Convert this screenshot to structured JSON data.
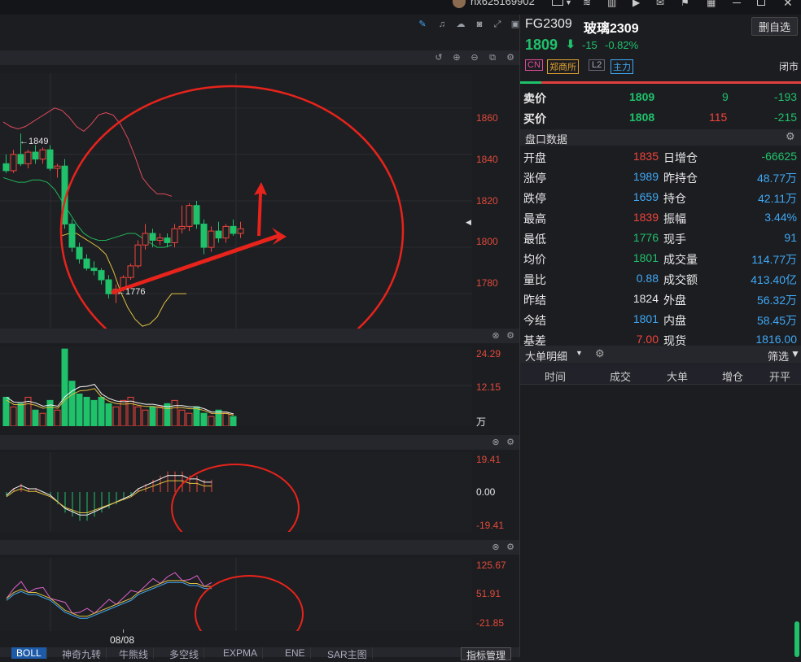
{
  "topbar": {
    "username": "hx625169902"
  },
  "pane_icons": {
    "toolbar_top": [
      "pen-icon",
      "bell-icon",
      "cloud-icon",
      "camera-icon",
      "fullscreen-icon",
      "layout-icon"
    ],
    "toolbar_chart": [
      "undo-icon",
      "zoom-in-icon",
      "zoom-out-icon",
      "crop-icon",
      "settings-icon"
    ]
  },
  "price_axis": [
    "1860",
    "1840",
    "1820",
    "1800",
    "1780"
  ],
  "volume_axis": [
    "24.29",
    "12.15",
    "万"
  ],
  "macd_axis": [
    "19.41",
    "0.00",
    "-19.41"
  ],
  "kdj_axis": [
    "125.67",
    "51.91",
    "-21.85"
  ],
  "annotations": {
    "high": "←1849",
    "low": "←1776"
  },
  "date_label": "08/08",
  "bottom_tabs": [
    "BOLL",
    "神奇九转",
    "牛熊线",
    "多空线",
    "EXPMA",
    "ENE",
    "SAR主图"
  ],
  "indicator_button": "指标管理",
  "quote": {
    "code": "FG2309",
    "name": "玻璃2309",
    "watch_button": "删自选",
    "price": "1809",
    "change": "-15",
    "change_pct": "-0.82%",
    "tags": [
      "CN",
      "郑商所",
      "L2",
      "主力"
    ],
    "status": "闭市"
  },
  "orderbook": [
    {
      "label": "卖价",
      "price": "1809",
      "vol": "9",
      "delta": "-193"
    },
    {
      "label": "买价",
      "price": "1808",
      "vol": "115",
      "delta": "-215"
    }
  ],
  "handicap_title": "盘口数据",
  "handicap": [
    {
      "l1": "开盘",
      "v1": "1835",
      "c1": "red",
      "l2": "日增仓",
      "v2": "-66625",
      "c2": "green"
    },
    {
      "l1": "涨停",
      "v1": "1989",
      "c1": "cyan",
      "l2": "昨持仓",
      "v2": "48.77万",
      "c2": "cyan"
    },
    {
      "l1": "跌停",
      "v1": "1659",
      "c1": "cyan",
      "l2": "持仓",
      "v2": "42.11万",
      "c2": "cyan"
    },
    {
      "l1": "最高",
      "v1": "1839",
      "c1": "red",
      "l2": "振幅",
      "v2": "3.44%",
      "c2": "cyan"
    },
    {
      "l1": "最低",
      "v1": "1776",
      "c1": "green",
      "l2": "现手",
      "v2": "91",
      "c2": "cyan"
    },
    {
      "l1": "均价",
      "v1": "1801",
      "c1": "green",
      "l2": "成交量",
      "v2": "114.77万",
      "c2": "cyan"
    },
    {
      "l1": "量比",
      "v1": "0.88",
      "c1": "cyan",
      "l2": "成交额",
      "v2": "413.40亿",
      "c2": "cyan"
    },
    {
      "l1": "昨结",
      "v1": "1824",
      "c1": "white",
      "l2": "外盘",
      "v2": "56.32万",
      "c2": "cyan"
    },
    {
      "l1": "今结",
      "v1": "1801",
      "c1": "cyan",
      "l2": "内盘",
      "v2": "58.45万",
      "c2": "cyan"
    },
    {
      "l1": "基差",
      "v1": "7.00",
      "c1": "red",
      "l2": "现货",
      "v2": "1816.00",
      "c2": "cyan"
    }
  ],
  "bigorder": {
    "title": "大单明细",
    "filter": "筛选",
    "columns": [
      "时间",
      "成交",
      "大单",
      "增仓",
      "开平"
    ]
  },
  "chart_data": {
    "type": "candlestick",
    "candles": [
      {
        "o": 1836,
        "h": 1840,
        "l": 1832,
        "c": 1833
      },
      {
        "o": 1833,
        "h": 1842,
        "l": 1832,
        "c": 1840
      },
      {
        "o": 1840,
        "h": 1849,
        "l": 1835,
        "c": 1836
      },
      {
        "o": 1836,
        "h": 1842,
        "l": 1834,
        "c": 1841
      },
      {
        "o": 1841,
        "h": 1844,
        "l": 1836,
        "c": 1838
      },
      {
        "o": 1838,
        "h": 1843,
        "l": 1836,
        "c": 1842
      },
      {
        "o": 1842,
        "h": 1844,
        "l": 1833,
        "c": 1834
      },
      {
        "o": 1834,
        "h": 1836,
        "l": 1830,
        "c": 1835
      },
      {
        "o": 1835,
        "h": 1838,
        "l": 1808,
        "c": 1810
      },
      {
        "o": 1810,
        "h": 1812,
        "l": 1798,
        "c": 1800
      },
      {
        "o": 1800,
        "h": 1802,
        "l": 1793,
        "c": 1795
      },
      {
        "o": 1795,
        "h": 1797,
        "l": 1790,
        "c": 1791
      },
      {
        "o": 1791,
        "h": 1794,
        "l": 1788,
        "c": 1790
      },
      {
        "o": 1790,
        "h": 1791,
        "l": 1784,
        "c": 1786
      },
      {
        "o": 1786,
        "h": 1788,
        "l": 1778,
        "c": 1780
      },
      {
        "o": 1780,
        "h": 1784,
        "l": 1776,
        "c": 1782
      },
      {
        "o": 1782,
        "h": 1788,
        "l": 1781,
        "c": 1787
      },
      {
        "o": 1787,
        "h": 1793,
        "l": 1786,
        "c": 1792
      },
      {
        "o": 1792,
        "h": 1803,
        "l": 1791,
        "c": 1801
      },
      {
        "o": 1801,
        "h": 1810,
        "l": 1799,
        "c": 1806
      },
      {
        "o": 1806,
        "h": 1808,
        "l": 1800,
        "c": 1803
      },
      {
        "o": 1803,
        "h": 1806,
        "l": 1801,
        "c": 1804
      },
      {
        "o": 1804,
        "h": 1806,
        "l": 1800,
        "c": 1802
      },
      {
        "o": 1802,
        "h": 1810,
        "l": 1800,
        "c": 1808
      },
      {
        "o": 1808,
        "h": 1818,
        "l": 1806,
        "c": 1809
      },
      {
        "o": 1809,
        "h": 1819,
        "l": 1807,
        "c": 1818
      },
      {
        "o": 1818,
        "h": 1820,
        "l": 1808,
        "c": 1810
      },
      {
        "o": 1810,
        "h": 1812,
        "l": 1797,
        "c": 1800
      },
      {
        "o": 1800,
        "h": 1809,
        "l": 1798,
        "c": 1807
      },
      {
        "o": 1807,
        "h": 1811,
        "l": 1802,
        "c": 1804
      },
      {
        "o": 1804,
        "h": 1810,
        "l": 1802,
        "c": 1809
      },
      {
        "o": 1809,
        "h": 1812,
        "l": 1805,
        "c": 1806
      },
      {
        "o": 1806,
        "h": 1811,
        "l": 1804,
        "c": 1808
      }
    ],
    "boll_upper": [
      1854,
      1852,
      1851,
      1852,
      1854,
      1856,
      1858,
      1860,
      1859,
      1856,
      1852,
      1850,
      1853,
      1857,
      1858,
      1857,
      1853,
      1847,
      1839,
      1830,
      1826,
      1823,
      1823,
      1822
    ],
    "boll_mid": [
      1830,
      1829,
      1828,
      1828,
      1829,
      1829,
      1828,
      1825,
      1820,
      1815,
      1810,
      1806,
      1804,
      1803,
      1803,
      1804,
      1805,
      1806,
      1806,
      1804,
      1802,
      1800,
      1800,
      1801
    ],
    "boll_lower": [
      1805,
      1806,
      1806,
      1804,
      1802,
      1800,
      1797,
      1790,
      1781,
      1774,
      1769,
      1766,
      1767,
      1770,
      1776,
      1780,
      1780,
      1780
    ],
    "ylim": [
      1765,
      1875
    ],
    "volume": [
      9,
      6,
      7,
      9,
      5,
      4,
      8,
      5,
      24,
      14,
      10,
      9,
      8,
      9,
      7,
      6,
      8,
      9,
      6,
      5,
      6,
      6,
      7,
      8,
      5,
      4,
      6,
      4,
      3,
      5,
      4,
      3
    ],
    "volume_ylim": [
      0,
      24.29
    ],
    "macd": [
      -1,
      1,
      2,
      1,
      1,
      0,
      -1,
      -3,
      -5,
      -6,
      -7,
      -7,
      -6,
      -5,
      -4,
      -3,
      -2,
      -1,
      1,
      2,
      3,
      4,
      5,
      5,
      5,
      4,
      4,
      3,
      3
    ],
    "macd_ylim": [
      -19.41,
      19.41
    ]
  }
}
